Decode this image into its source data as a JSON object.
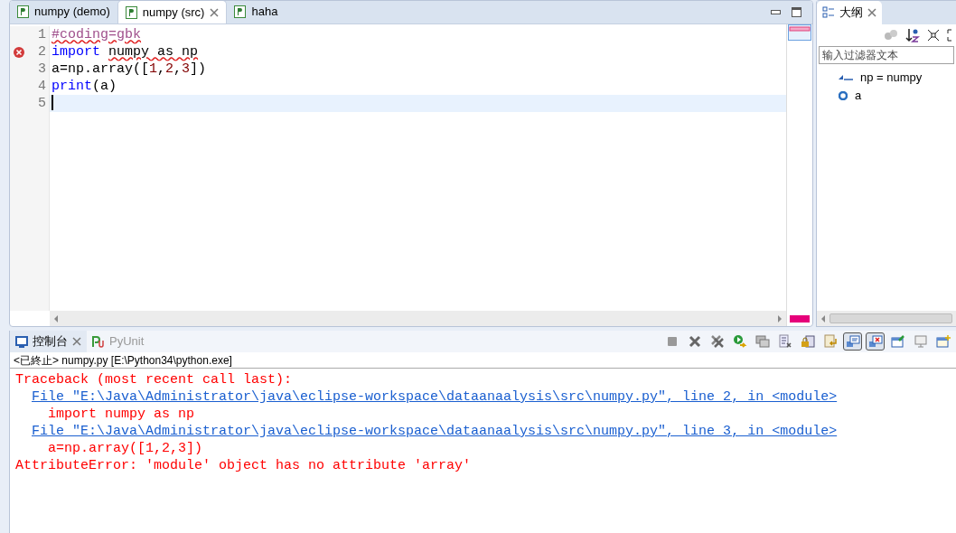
{
  "editor": {
    "tabs": [
      {
        "label": "numpy (demo)",
        "selected": false
      },
      {
        "label": "numpy (src)",
        "selected": true
      },
      {
        "label": "haha",
        "selected": false
      }
    ],
    "lines": [
      {
        "number": "1",
        "error": false,
        "current": false,
        "tokens": [
          {
            "kind": "comment",
            "text": "#coding=gbk",
            "squiggle": true
          }
        ]
      },
      {
        "number": "2",
        "error": true,
        "current": false,
        "tokens": [
          {
            "kind": "keyword",
            "text": "import ",
            "squiggle": false
          },
          {
            "kind": "plain",
            "text": "numpy as np",
            "squiggle": true
          }
        ]
      },
      {
        "number": "3",
        "error": false,
        "current": false,
        "tokens": [
          {
            "kind": "plain",
            "text": "a=np.array([",
            "squiggle": false
          },
          {
            "kind": "number",
            "text": "1",
            "squiggle": false
          },
          {
            "kind": "plain",
            "text": ",",
            "squiggle": false
          },
          {
            "kind": "number",
            "text": "2",
            "squiggle": false
          },
          {
            "kind": "plain",
            "text": ",",
            "squiggle": false
          },
          {
            "kind": "number",
            "text": "3",
            "squiggle": false
          },
          {
            "kind": "plain",
            "text": "])",
            "squiggle": false
          }
        ]
      },
      {
        "number": "4",
        "error": false,
        "current": false,
        "tokens": [
          {
            "kind": "keyword",
            "text": "print",
            "squiggle": false
          },
          {
            "kind": "plain",
            "text": "(a)",
            "squiggle": false
          }
        ]
      },
      {
        "number": "5",
        "error": false,
        "current": true
      }
    ]
  },
  "outline": {
    "tab": {
      "label": "大纲",
      "selected": true
    },
    "filter": {
      "placeholder": "输入过滤器文本"
    },
    "items": [
      {
        "kind": "import",
        "label": "np = numpy"
      },
      {
        "kind": "variable",
        "label": "a"
      }
    ]
  },
  "console": {
    "tabs": [
      {
        "label": "控制台",
        "selected": true
      },
      {
        "label": "PyUnit",
        "selected": false
      }
    ],
    "toolbar": [
      {
        "kind": "stop",
        "on": false
      },
      {
        "kind": "remove",
        "on": false
      },
      {
        "kind": "remove-all",
        "on": false
      },
      {
        "kind": "run",
        "on": false
      },
      {
        "kind": "windows",
        "on": false
      },
      {
        "kind": "clear",
        "on": false
      },
      {
        "kind": "lock",
        "on": false
      },
      {
        "kind": "wrap",
        "on": false
      },
      {
        "kind": "show-out",
        "on": true
      },
      {
        "kind": "show-err",
        "on": true
      },
      {
        "kind": "pin",
        "on": false
      },
      {
        "kind": "display",
        "on": false
      },
      {
        "kind": "new",
        "on": false
      }
    ],
    "status": "<已終止> numpy.py [E:\\Python34\\python.exe]",
    "output": [
      {
        "kind": "error",
        "text": "Traceback (most recent call last):",
        "indent": false
      },
      {
        "kind": "link",
        "text": "File \"E:\\Java\\Administrator\\java\\eclipse-workspace\\dataanaalysis\\src\\numpy.py\", line 2, in <module>",
        "indent": true
      },
      {
        "kind": "error",
        "text": "import numpy as np",
        "indent": true
      },
      {
        "kind": "link",
        "text": "File \"E:\\Java\\Administrator\\java\\eclipse-workspace\\dataanaalysis\\src\\numpy.py\", line 3, in <module>",
        "indent": true
      },
      {
        "kind": "error",
        "text": "a=np.array([1,2,3])",
        "indent": true
      },
      {
        "kind": "error",
        "text": "AttributeError: 'module' object has no attribute 'array'",
        "indent": false
      }
    ]
  }
}
